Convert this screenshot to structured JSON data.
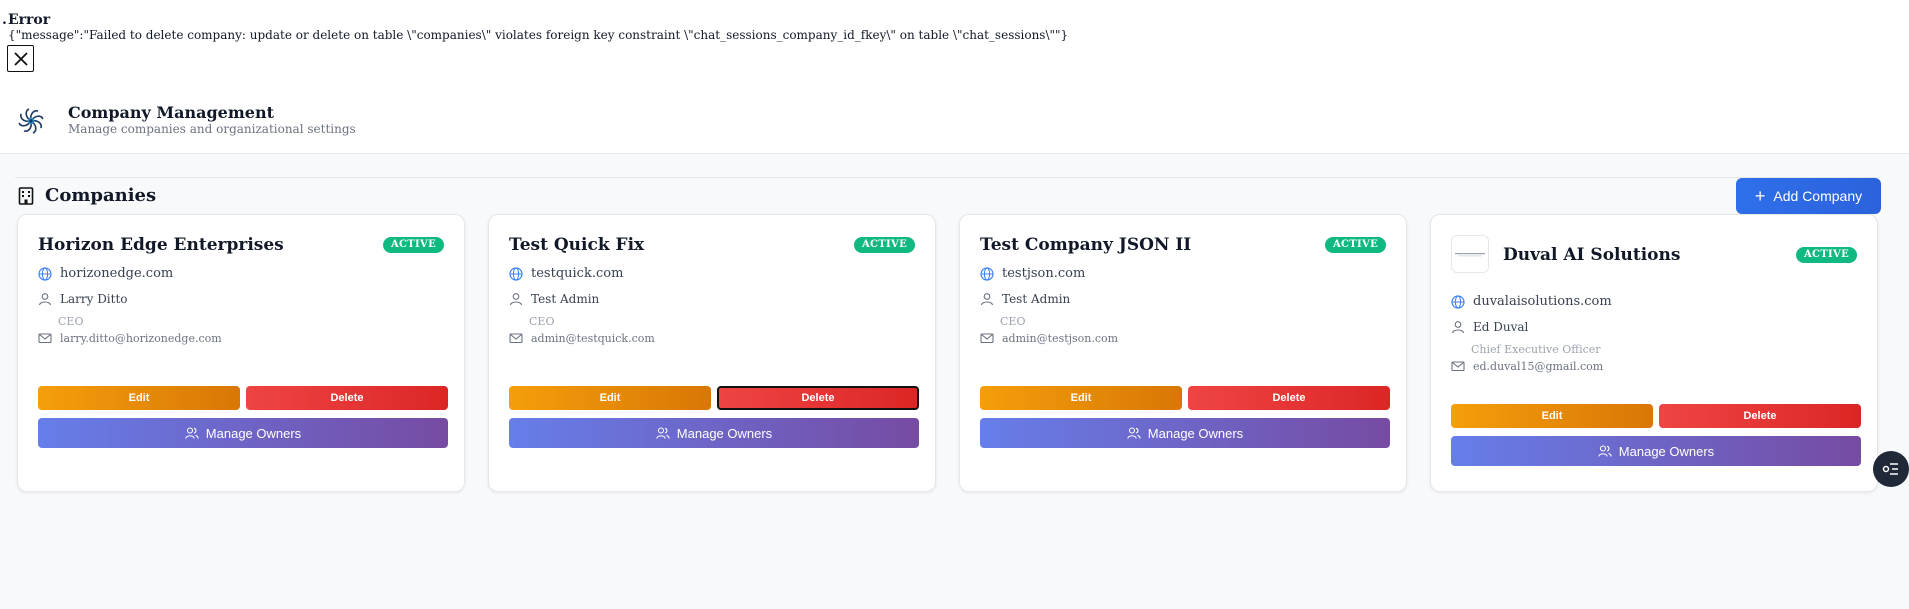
{
  "error": {
    "title": "Error",
    "message": "{\"message\":\"Failed to delete company: update or delete on table \\\"companies\\\" violates foreign key constraint \\\"chat_sessions_company_id_fkey\\\" on table \\\"chat_sessions\\\"\"}"
  },
  "header": {
    "title": "Company Management",
    "subtitle": "Manage companies and organizational settings"
  },
  "section": {
    "title": "Companies",
    "add_button": "Add Company"
  },
  "cards": [
    {
      "name": "Horizon Edge Enterprises",
      "status": "ACTIVE",
      "website": "horizonedge.com",
      "contact": "Larry Ditto",
      "role": "CEO",
      "email": "larry.ditto@horizonedge.com",
      "edit": "Edit",
      "delete": "Delete",
      "owners": "Manage Owners"
    },
    {
      "name": "Test Quick Fix",
      "status": "ACTIVE",
      "website": "testquick.com",
      "contact": "Test Admin",
      "role": "CEO",
      "email": "admin@testquick.com",
      "edit": "Edit",
      "delete": "Delete",
      "owners": "Manage Owners"
    },
    {
      "name": "Test Company JSON II",
      "status": "ACTIVE",
      "website": "testjson.com",
      "contact": "Test Admin",
      "role": "CEO",
      "email": "admin@testjson.com",
      "edit": "Edit",
      "delete": "Delete",
      "owners": "Manage Owners"
    },
    {
      "name": "Duval AI Solutions",
      "status": "ACTIVE",
      "website": "duvalaisolutions.com",
      "contact": "Ed Duval",
      "role": "Chief Executive Officer",
      "email": "ed.duval15@gmail.com",
      "edit": "Edit",
      "delete": "Delete",
      "owners": "Manage Owners"
    }
  ],
  "colors": {
    "accent": "#2f6fea",
    "active": "#10b981",
    "edit": "#f59e0b",
    "delete": "#ef4444",
    "owners_start": "#667eea",
    "owners_end": "#764ba2"
  },
  "icons": [
    "close-icon",
    "pinwheel-logo-icon",
    "building-icon",
    "plus-icon",
    "globe-icon",
    "user-icon",
    "mail-icon",
    "users-icon",
    "company-logo-image",
    "list-settings-icon"
  ]
}
